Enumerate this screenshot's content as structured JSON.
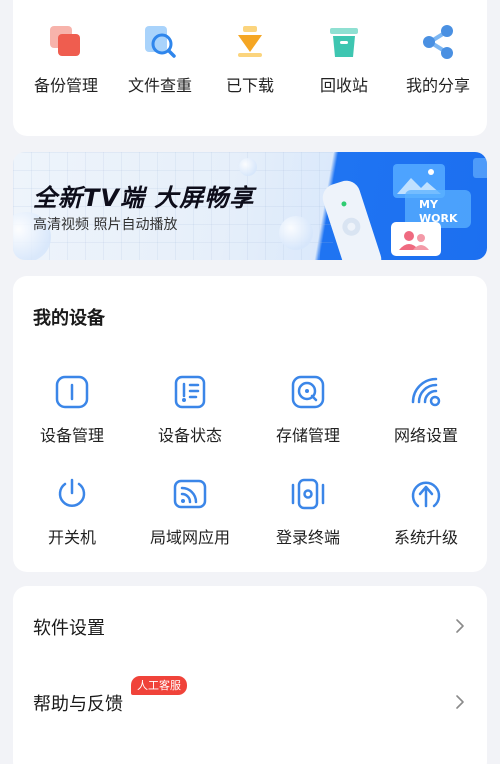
{
  "quick_actions": [
    {
      "label": "备份管理",
      "icon": "backup-icon",
      "color": "#f0675a"
    },
    {
      "label": "文件查重",
      "icon": "file-dedupe-icon",
      "color": "#5aa8f5"
    },
    {
      "label": "已下载",
      "icon": "download-icon",
      "color": "#f5a623"
    },
    {
      "label": "回收站",
      "icon": "recycle-bin-icon",
      "color": "#3ec6b1"
    },
    {
      "label": "我的分享",
      "icon": "share-icon",
      "color": "#4a90e2"
    }
  ],
  "banner": {
    "title": "全新TV端  大屏畅享",
    "subtitle": "高清视频  照片自动播放",
    "art_text_line1": "MY",
    "art_text_line2": "WORK"
  },
  "devices": {
    "title": "我的设备",
    "accent": "#3b86e8",
    "items": [
      {
        "label": "设备管理",
        "icon": "device-manage-icon"
      },
      {
        "label": "设备状态",
        "icon": "device-status-icon"
      },
      {
        "label": "存储管理",
        "icon": "storage-manage-icon"
      },
      {
        "label": "网络设置",
        "icon": "network-settings-icon"
      },
      {
        "label": "开关机",
        "icon": "power-icon"
      },
      {
        "label": "局域网应用",
        "icon": "lan-app-icon"
      },
      {
        "label": "登录终端",
        "icon": "login-terminal-icon"
      },
      {
        "label": "系统升级",
        "icon": "system-upgrade-icon"
      }
    ]
  },
  "settings": {
    "items": [
      {
        "label": "软件设置"
      },
      {
        "label": "帮助与反馈",
        "badge": "人工客服"
      }
    ]
  }
}
